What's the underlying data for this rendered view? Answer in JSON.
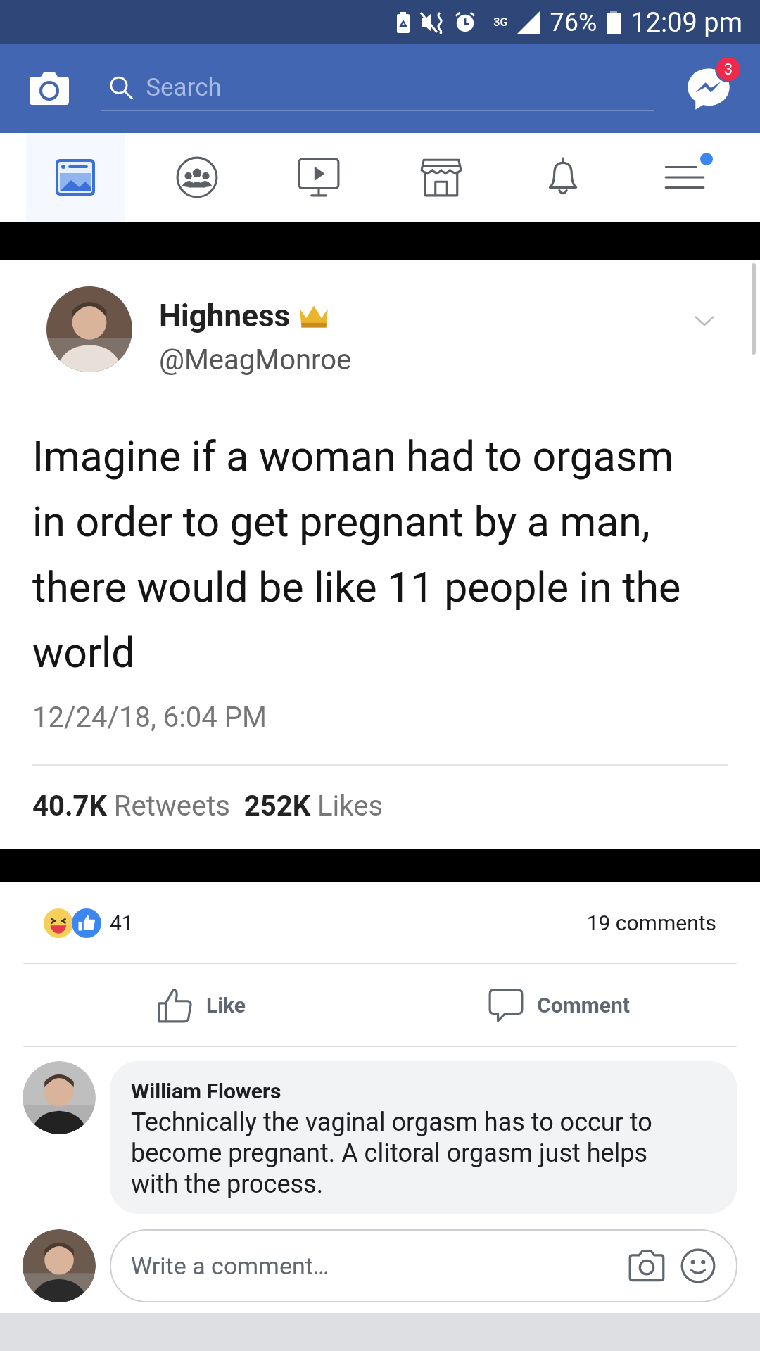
{
  "status_bar": {
    "battery_percent": "76%",
    "time": "12:09 pm",
    "network": "3G"
  },
  "header": {
    "search": {
      "placeholder": "Search"
    },
    "messenger_badge": "3"
  },
  "nav_tabs": [
    {
      "kind": "feed",
      "selected": true,
      "dot": false
    },
    {
      "kind": "groups",
      "selected": false,
      "dot": false
    },
    {
      "kind": "watch",
      "selected": false,
      "dot": false
    },
    {
      "kind": "marketplace",
      "selected": false,
      "dot": false
    },
    {
      "kind": "notifications",
      "selected": false,
      "dot": false
    },
    {
      "kind": "menu",
      "selected": false,
      "dot": true
    }
  ],
  "tweet": {
    "name": "Highness",
    "handle": "@MeagMonroe",
    "text": "Imagine if a woman had to orgasm in order to get pregnant by a man, there would be like 11 people in the world",
    "date": "12/24/18, 6:04 PM",
    "stats": "**40.7K** Retweets  **252K** Likes"
  },
  "reactions": {
    "count": "41",
    "comments": "19 comments"
  },
  "actions": [
    {
      "kind": "like",
      "label": "Like"
    },
    {
      "kind": "comment",
      "label": "Comment"
    }
  ],
  "comments": [
    {
      "author": "William Flowers",
      "text": "Technically the vaginal orgasm has to occur to become pregnant. A clitoral orgasm just helps with the process."
    }
  ],
  "composer": {
    "placeholder": "Write a comment…"
  }
}
